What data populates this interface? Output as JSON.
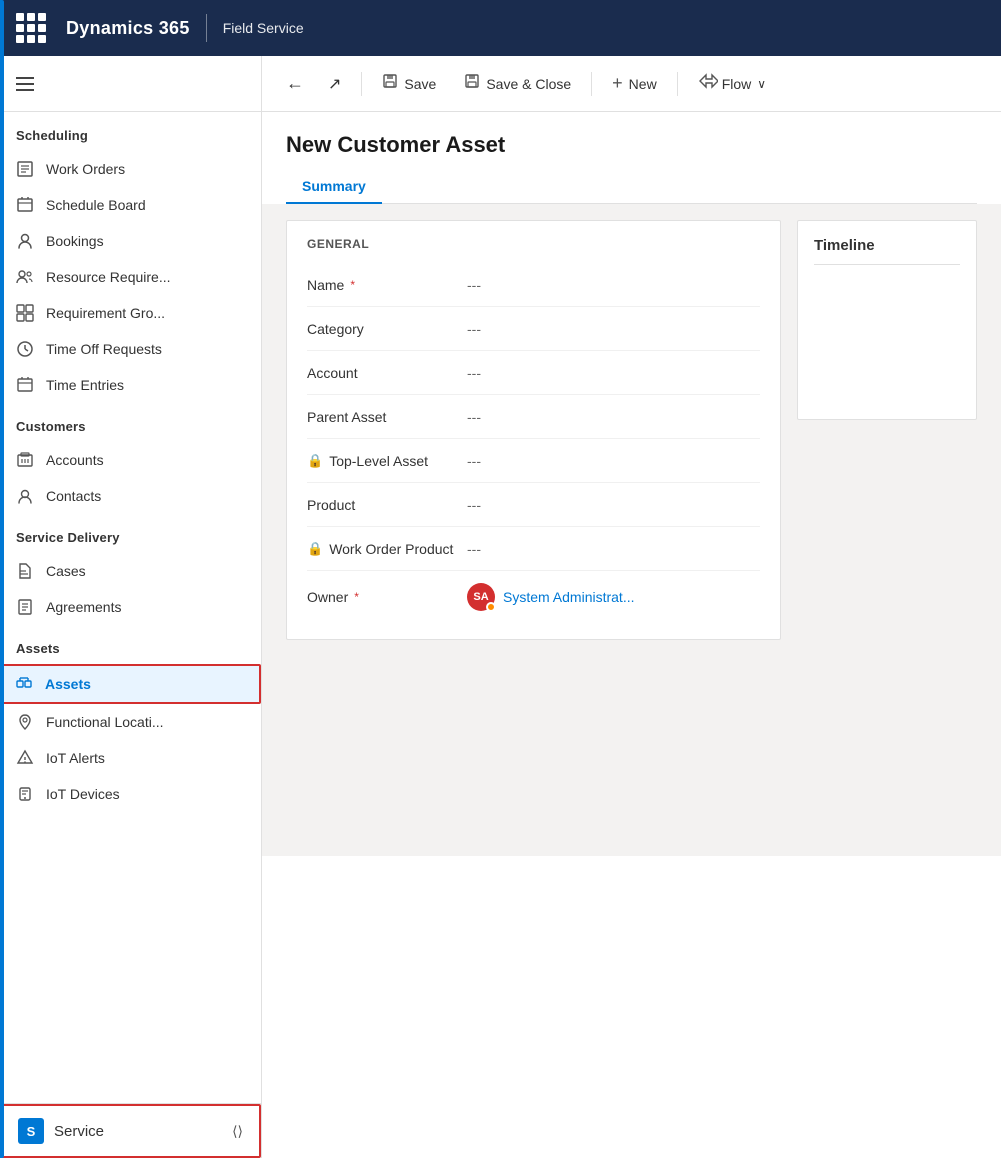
{
  "topbar": {
    "app_name": "Dynamics 365",
    "module_name": "Field Service"
  },
  "sidebar": {
    "hamburger_label": "Menu",
    "sections": [
      {
        "label": "Scheduling",
        "items": [
          {
            "id": "work-orders",
            "label": "Work Orders",
            "icon": "📋"
          },
          {
            "id": "schedule-board",
            "label": "Schedule Board",
            "icon": "📅"
          },
          {
            "id": "bookings",
            "label": "Bookings",
            "icon": "👤"
          },
          {
            "id": "resource-require",
            "label": "Resource Require...",
            "icon": "👥"
          },
          {
            "id": "requirement-gro",
            "label": "Requirement Gro...",
            "icon": "🔲"
          },
          {
            "id": "time-off-requests",
            "label": "Time Off Requests",
            "icon": "🏖"
          },
          {
            "id": "time-entries",
            "label": "Time Entries",
            "icon": "📆"
          }
        ]
      },
      {
        "label": "Customers",
        "items": [
          {
            "id": "accounts",
            "label": "Accounts",
            "icon": "🏢"
          },
          {
            "id": "contacts",
            "label": "Contacts",
            "icon": "👤"
          }
        ]
      },
      {
        "label": "Service Delivery",
        "items": [
          {
            "id": "cases",
            "label": "Cases",
            "icon": "🔧"
          },
          {
            "id": "agreements",
            "label": "Agreements",
            "icon": "📄"
          }
        ]
      },
      {
        "label": "Assets",
        "items": [
          {
            "id": "assets",
            "label": "Assets",
            "icon": "🎯",
            "active": true
          },
          {
            "id": "functional-locati",
            "label": "Functional Locati...",
            "icon": "📍"
          },
          {
            "id": "iot-alerts",
            "label": "IoT Alerts",
            "icon": "🔔"
          },
          {
            "id": "iot-devices",
            "label": "IoT Devices",
            "icon": "📡"
          }
        ]
      }
    ],
    "service_item": {
      "label": "Service",
      "icon_letter": "S"
    }
  },
  "toolbar": {
    "back_label": "←",
    "open_label": "↗",
    "save_label": "Save",
    "save_close_label": "Save & Close",
    "new_label": "New",
    "flow_label": "Flow",
    "dropdown_arrow": "∨"
  },
  "page": {
    "title": "New Customer Asset",
    "tabs": [
      {
        "id": "summary",
        "label": "Summary",
        "active": true
      }
    ]
  },
  "form": {
    "general_section_title": "GENERAL",
    "fields": [
      {
        "id": "name",
        "label": "Name",
        "required": true,
        "locked": false,
        "value": "---"
      },
      {
        "id": "category",
        "label": "Category",
        "required": false,
        "locked": false,
        "value": "---"
      },
      {
        "id": "account",
        "label": "Account",
        "required": false,
        "locked": false,
        "value": "---"
      },
      {
        "id": "parent-asset",
        "label": "Parent Asset",
        "required": false,
        "locked": false,
        "value": "---"
      },
      {
        "id": "top-level-asset",
        "label": "Top-Level Asset",
        "required": false,
        "locked": true,
        "value": "---"
      },
      {
        "id": "product",
        "label": "Product",
        "required": false,
        "locked": false,
        "value": "---"
      },
      {
        "id": "work-order-product",
        "label": "Work Order Product",
        "required": false,
        "locked": true,
        "value": "---"
      },
      {
        "id": "owner",
        "label": "Owner",
        "required": true,
        "locked": false,
        "value": "System Administrat...",
        "is_owner": true,
        "avatar_initials": "SA"
      }
    ]
  },
  "timeline": {
    "title": "Timeline"
  }
}
